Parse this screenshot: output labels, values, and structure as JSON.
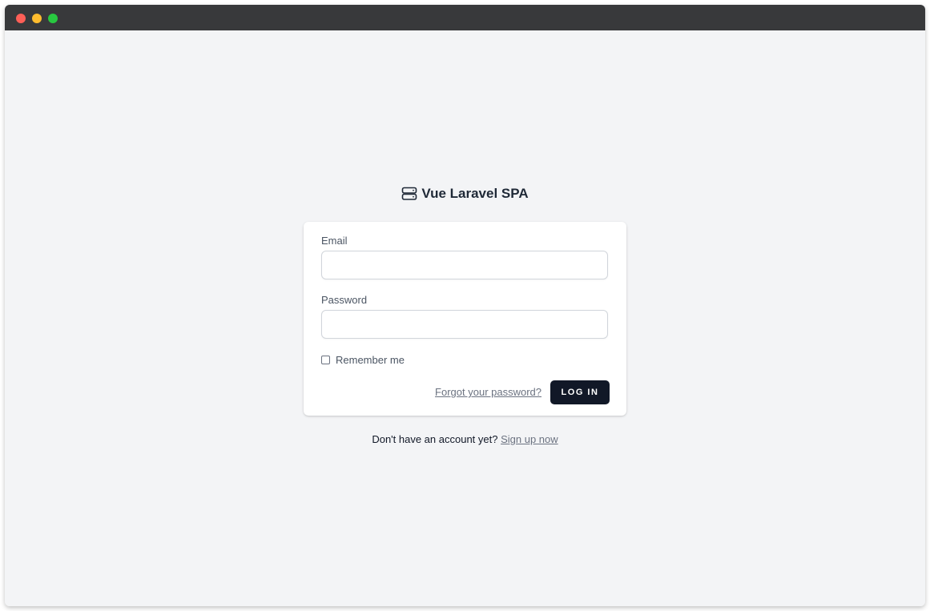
{
  "window": {
    "controls": {
      "close_color": "#fe5f57",
      "minimize_color": "#febc2e",
      "maximize_color": "#28c840"
    }
  },
  "brand": {
    "icon": "server-icon",
    "title": "Vue Laravel SPA"
  },
  "login_form": {
    "email_label": "Email",
    "email_value": "",
    "password_label": "Password",
    "password_value": "",
    "remember_label": "Remember me",
    "remember_checked": false,
    "forgot_link": "Forgot your password?",
    "login_button": "LOG IN"
  },
  "signup": {
    "prompt": "Don't have an account yet?",
    "link": "Sign up now"
  },
  "colors": {
    "background": "#f3f4f6",
    "button": "#111827",
    "text_dark": "#1f2937",
    "text_muted": "#6b7280"
  }
}
